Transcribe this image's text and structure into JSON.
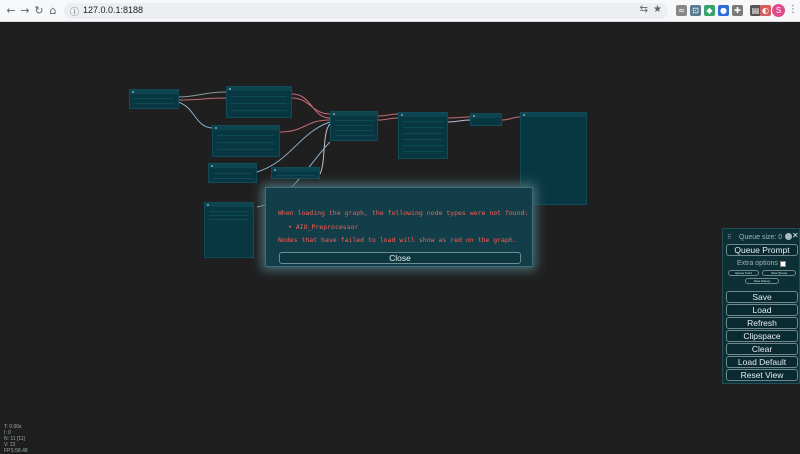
{
  "browser": {
    "url": "127.0.0.1:8188",
    "nav": {
      "back": "←",
      "forward": "→",
      "reload": "↻",
      "home": "⌂"
    },
    "lock_glyph": "ⓘ",
    "translate_glyph": "⇆",
    "star_glyph": "★",
    "avatar_letter": "S",
    "menu_glyph": "⋮",
    "extensions": [
      {
        "glyph": "≈",
        "color": "#888888"
      },
      {
        "glyph": "⊡",
        "color": "#5a7b8f"
      },
      {
        "glyph": "◆",
        "color": "#3aa36a"
      },
      {
        "glyph": "●",
        "color": "#2b6cd6"
      },
      {
        "glyph": "✚",
        "color": "#7a7a7a"
      },
      {
        "glyph": "▤",
        "color": "#555555"
      },
      {
        "glyph": "◐",
        "color": "#d85c5c"
      }
    ]
  },
  "canvas": {
    "stats": [
      "T: 0.00s",
      "I: 0",
      "N: 11 [11]",
      "V: 22",
      "FPS:58.48"
    ]
  },
  "dialog": {
    "line1": "When loading the graph, the following node types were not found:",
    "missing_node": "• AIO_Preprocessor",
    "line2": "Nodes that have failed to load will show as red on the graph.",
    "close_label": "Close"
  },
  "menu": {
    "drag_handle": "⠿",
    "queue_size": "Queue size: 0",
    "close_glyph": "✕",
    "queue_prompt": "Queue Prompt",
    "extra_options": "Extra options",
    "mini_buttons": [
      "Queue Front",
      "View Queue",
      "View History"
    ],
    "buttons": [
      "Save",
      "Load",
      "Refresh",
      "Clipspace",
      "Clear",
      "Load Default",
      "Reset View"
    ]
  },
  "colors": {
    "node_bg": "#083742",
    "error_text": "#ff5b52",
    "canvas_bg": "#1f1f1f"
  }
}
